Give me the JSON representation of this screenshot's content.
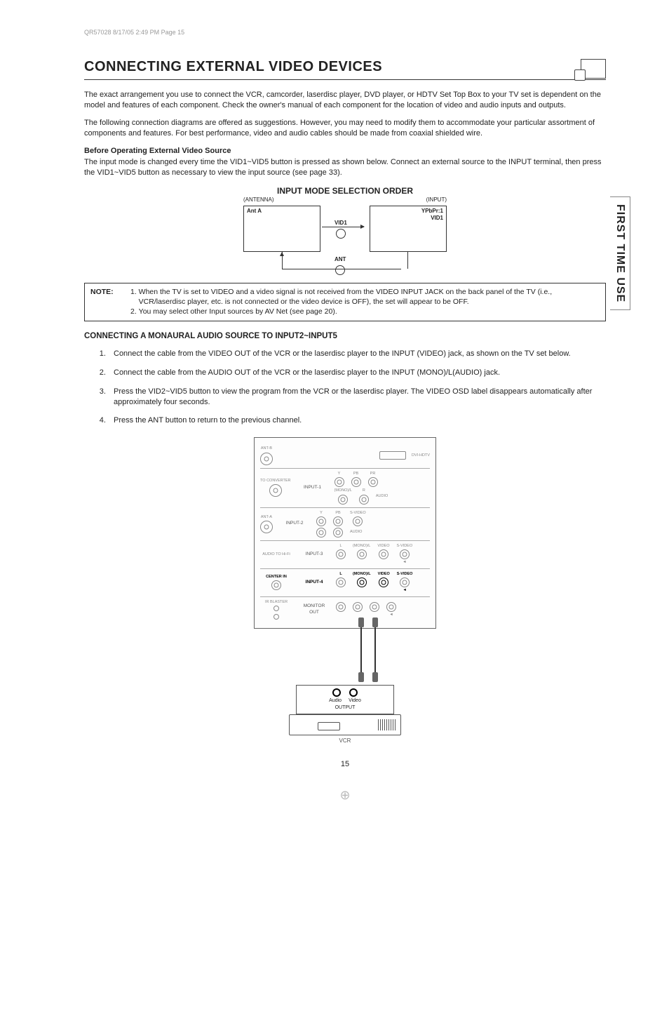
{
  "sideTab": "FIRST TIME USE",
  "cropMark": "QR57028  8/17/05  2:49 PM  Page 15",
  "heading": "CONNECTING EXTERNAL VIDEO DEVICES",
  "intro1": "The exact arrangement you use to connect the VCR, camcorder, laserdisc player, DVD player, or HDTV Set Top Box to your TV set is dependent on the model and features of each component.  Check the owner's manual of each component for the location of video and audio inputs and outputs.",
  "intro2": "The following connection diagrams are offered as suggestions.  However, you may need to modify them to accommodate your particular assortment of components and features.  For best performance, video and audio cables should be made from coaxial shielded wire.",
  "beforeHead": "Before Operating External Video Source",
  "beforeBody": "The input mode is changed every time the VID1~VID5 button is pressed as shown below.  Connect an external source to the INPUT terminal, then press the VID1~VID5 button as necessary to view the input source (see page 33).",
  "flowTitle": "INPUT MODE SELECTION ORDER",
  "flowSubL": "(ANTENNA)",
  "flowSubR": "(INPUT)",
  "flowAntA": "Ant A",
  "flowYP": "YPbPr:1",
  "flowVid1R": "VID1",
  "flowVid1M": "VID1",
  "flowAntM": "ANT",
  "noteLabel": "NOTE:",
  "note1": "When the TV is set to VIDEO and a video signal is not received from the VIDEO INPUT JACK on the back panel of the TV (i.e., VCR/laserdisc player, etc. is not connected or the video device is OFF), the set will appear to be OFF.",
  "note2": "You may select other Input sources by AV Net (see page 20).",
  "sectionHead": "CONNECTING A MONAURAL AUDIO SOURCE TO INPUT2~INPUT5",
  "step1": "Connect the cable from the VIDEO OUT of the VCR or the laserdisc player to the INPUT (VIDEO) jack, as shown on the TV set below.",
  "step2": "Connect the cable from the AUDIO OUT of the VCR or the laserdisc player to the INPUT (MONO)/L(AUDIO) jack.",
  "step3": "Press the VID2~VID5 button to view the program from the VCR or the laserdisc player.  The VIDEO OSD label disappears automatically after approximately four seconds.",
  "step4": "Press the ANT button to return to the previous channel.",
  "panel": {
    "antB": "ANT-B",
    "toConv": "TO CONVERTER",
    "antA": "ANT-A",
    "in1": "INPUT-1",
    "in2": "INPUT-2",
    "in3": "INPUT-3",
    "in4": "INPUT-4",
    "monOut": "MONITOR OUT",
    "dviHdtv": "DVI-HDTV",
    "y": "Y",
    "pb": "PB",
    "pr": "PR",
    "l": "L",
    "monoL": "(MONO)/L",
    "r": "R",
    "audio": "AUDIO",
    "video": "VIDEO",
    "svideo": "S-VIDEO",
    "audioHiFi": "AUDIO TO Hi-Fi",
    "center": "CENTER IN",
    "irBlaster": "IR BLASTER"
  },
  "vcr": {
    "audio": "Audio",
    "video": "Video",
    "output": "OUTPUT",
    "caption": "VCR"
  },
  "pageNum": "15"
}
